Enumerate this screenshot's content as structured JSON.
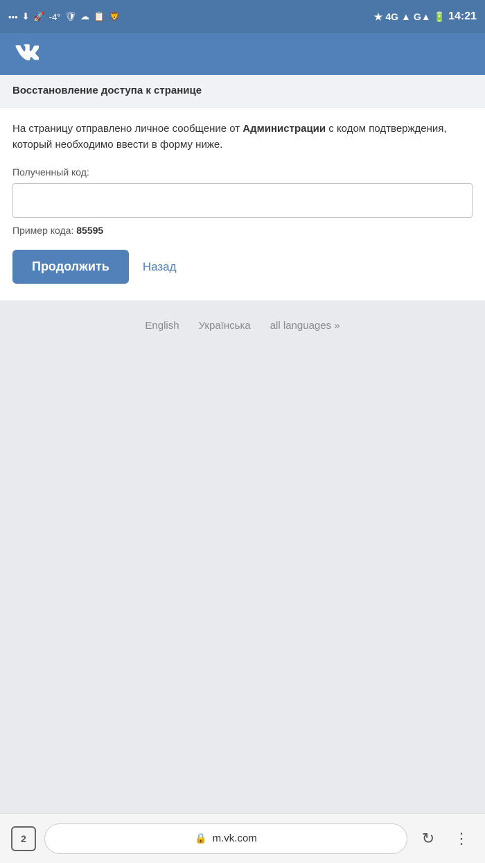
{
  "statusBar": {
    "time": "14:21",
    "temperature": "-4°",
    "signal": "4G",
    "battery": "full"
  },
  "header": {
    "logo": "ВК"
  },
  "pageTitleBar": {
    "title": "Восстановление доступа к странице"
  },
  "form": {
    "descriptionPart1": "На страницу отправлено личное сообщение от ",
    "descriptionBold": "Администрации",
    "descriptionPart2": " с кодом подтверждения, который необходимо ввести в форму ниже.",
    "fieldLabel": "Полученный код:",
    "inputPlaceholder": "",
    "exampleLabel": "Пример кода: ",
    "exampleCode": "85595",
    "continueButton": "Продолжить",
    "backLink": "Назад"
  },
  "footer": {
    "languages": [
      {
        "label": "English"
      },
      {
        "label": "Українська"
      },
      {
        "label": "all languages »"
      }
    ]
  },
  "browserBar": {
    "tabCount": "2",
    "url": "m.vk.com"
  }
}
